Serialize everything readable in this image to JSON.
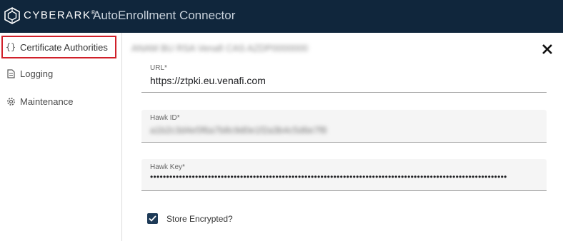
{
  "header": {
    "brand": "CYBERARK",
    "trademark": "®",
    "app_title": "AutoEnrollment Connector",
    "logo_icon": "cyberark-logo-icon",
    "background": "#10263c"
  },
  "sidebar": {
    "items": [
      {
        "label": "Certificate Authorities",
        "icon": "curly-braces-icon",
        "selected": true
      },
      {
        "label": "Logging",
        "icon": "document-icon"
      },
      {
        "label": "Maintenance",
        "icon": "gear-icon"
      }
    ],
    "highlight_color": "#d0202a"
  },
  "panel": {
    "title": "ANAM BU RSA Venafi CAS AZDP0000000",
    "close_icon": "close-icon"
  },
  "form": {
    "url": {
      "label": "URL*",
      "value": "https://ztpki.eu.venafi.com"
    },
    "hawk_id": {
      "label": "Hawk ID*",
      "value": "a1b2c3d4e5f6a7b8c9d0e1f2a3b4c5d6e7f8"
    },
    "hawk_key": {
      "label": "Hawk Key*",
      "value": "•••••••••••••••••••••••••••••••••••••••••••••••••••••••••••••••••••••••••••••••••••••••••••••••••••••••••••••••"
    },
    "store_encrypted": {
      "label": "Store Encrypted?",
      "checked": true,
      "icon": "checkmark-icon"
    }
  }
}
